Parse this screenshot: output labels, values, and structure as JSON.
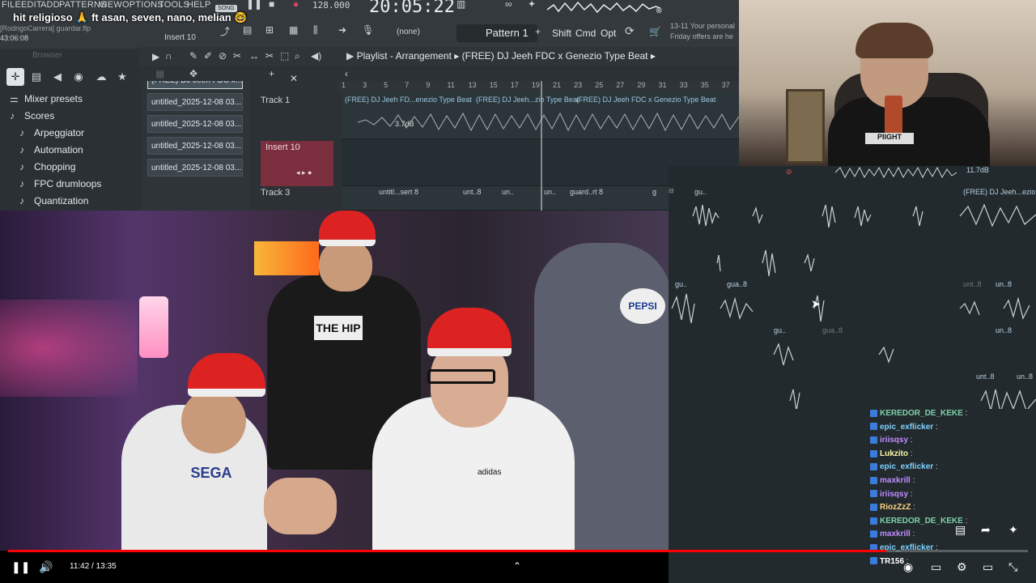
{
  "daw": {
    "menu": [
      "FILE",
      "EDIT",
      "ADD",
      "PATTERNS",
      "VIEW",
      "OPTIONS",
      "TOOLS",
      "HELP"
    ],
    "song_badge": "SONG",
    "tempo": "128.000",
    "clock": "20:05:22",
    "file_label": "[RodrigoCarrera] guardar.flp",
    "time_label": "43:06:08",
    "insert_label": "Insert 10",
    "none_label": "(none)",
    "pattern": "Pattern 1",
    "keys": [
      "Shift",
      "Cmd",
      "Opt"
    ],
    "news": [
      "13-11  Your personal",
      "Friday offers are he"
    ],
    "browser_head": "Browser",
    "browser_items": [
      {
        "label": "Mixer presets",
        "icon": "mixer-icon",
        "indent": 0
      },
      {
        "label": "Scores",
        "icon": "note-icon",
        "indent": 0
      },
      {
        "label": "Arpeggiator",
        "icon": "note-icon",
        "indent": 1
      },
      {
        "label": "Automation",
        "icon": "note-icon",
        "indent": 1
      },
      {
        "label": "Chopping",
        "icon": "note-icon",
        "indent": 1
      },
      {
        "label": "FPC drumloops",
        "icon": "note-icon",
        "indent": 1
      },
      {
        "label": "Quantization",
        "icon": "note-icon",
        "indent": 1
      }
    ],
    "picker": [
      "(FREE) DJ Jeeh FDC x...",
      "untitled_2025-12-08 03...",
      "untitled_2025-12-08 03...",
      "untitled_2025-12-08 03...",
      "untitled_2025-12-08 03..."
    ],
    "playlist_title": "Playlist - Arrangement",
    "playlist_path": "(FREE) DJ Jeeh FDC x Genezio Type Beat",
    "ruler": [
      "1",
      "3",
      "5",
      "7",
      "9",
      "11",
      "13",
      "15",
      "17",
      "19",
      "21",
      "23",
      "25",
      "27",
      "29",
      "31",
      "33",
      "35",
      "37"
    ],
    "tracks": [
      {
        "name": "Track 1"
      },
      {
        "name": "Insert 10"
      },
      {
        "name": "Track 3"
      }
    ],
    "track1_clips": [
      "(FREE) DJ Jeeh FD...enezio Type Beat",
      "(FREE) DJ Jeeh...zio Type Beat",
      "(FREE) DJ Jeeh FDC x Genezio Type Beat"
    ],
    "track1_db": "3.7dB",
    "track3_clips": [
      "untitl...sert 8",
      "unt..8",
      "un..",
      "un..",
      "guard..rt 8",
      "g"
    ],
    "right_clips": [
      "gu..",
      "(FREE) DJ Jeeh...ezio",
      "gu..",
      "gua..8",
      "gu..",
      "gua..8",
      "unt..8",
      "un..8",
      "un..8",
      "unt..8",
      "un..8",
      "11.7dB"
    ]
  },
  "stream": {
    "title": "hit religioso 🙏 ft asan, seven, nano, melian 🤓"
  },
  "chat": [
    {
      "user": "KEREDOR_DE_KEKE",
      "msg": ":",
      "color": "#7fd1a8"
    },
    {
      "user": "epic_exflicker",
      "msg": ":",
      "color": "#7fd1ff"
    },
    {
      "user": "iriisqsy",
      "msg": ":",
      "color": "#c08cff"
    },
    {
      "user": "Lukzito",
      "msg": ":",
      "color": "#fff7a8"
    },
    {
      "user": "epic_exflicker",
      "msg": ":",
      "color": "#7fd1ff"
    },
    {
      "user": "maxkrill",
      "msg": ":",
      "color": "#c08cff"
    },
    {
      "user": "iriisqsy",
      "msg": ":",
      "color": "#c08cff"
    },
    {
      "user": "RiozZzZ",
      "msg": ":",
      "color": "#ffd27f"
    },
    {
      "user": "KEREDOR_DE_KEKE",
      "msg": ":",
      "color": "#7fd1a8"
    },
    {
      "user": "maxkrill",
      "msg": ":",
      "color": "#c08cff"
    },
    {
      "user": "epic_exflicker",
      "msg": ":",
      "color": "#7fd1ff"
    },
    {
      "user": "TR156",
      "msg": ":",
      "color": "#ffffff"
    }
  ],
  "player": {
    "current": "11:42",
    "duration": "13:35",
    "time_text": "11:42 / 13:35",
    "progress": 0.861,
    "accent": "#ff0000"
  }
}
